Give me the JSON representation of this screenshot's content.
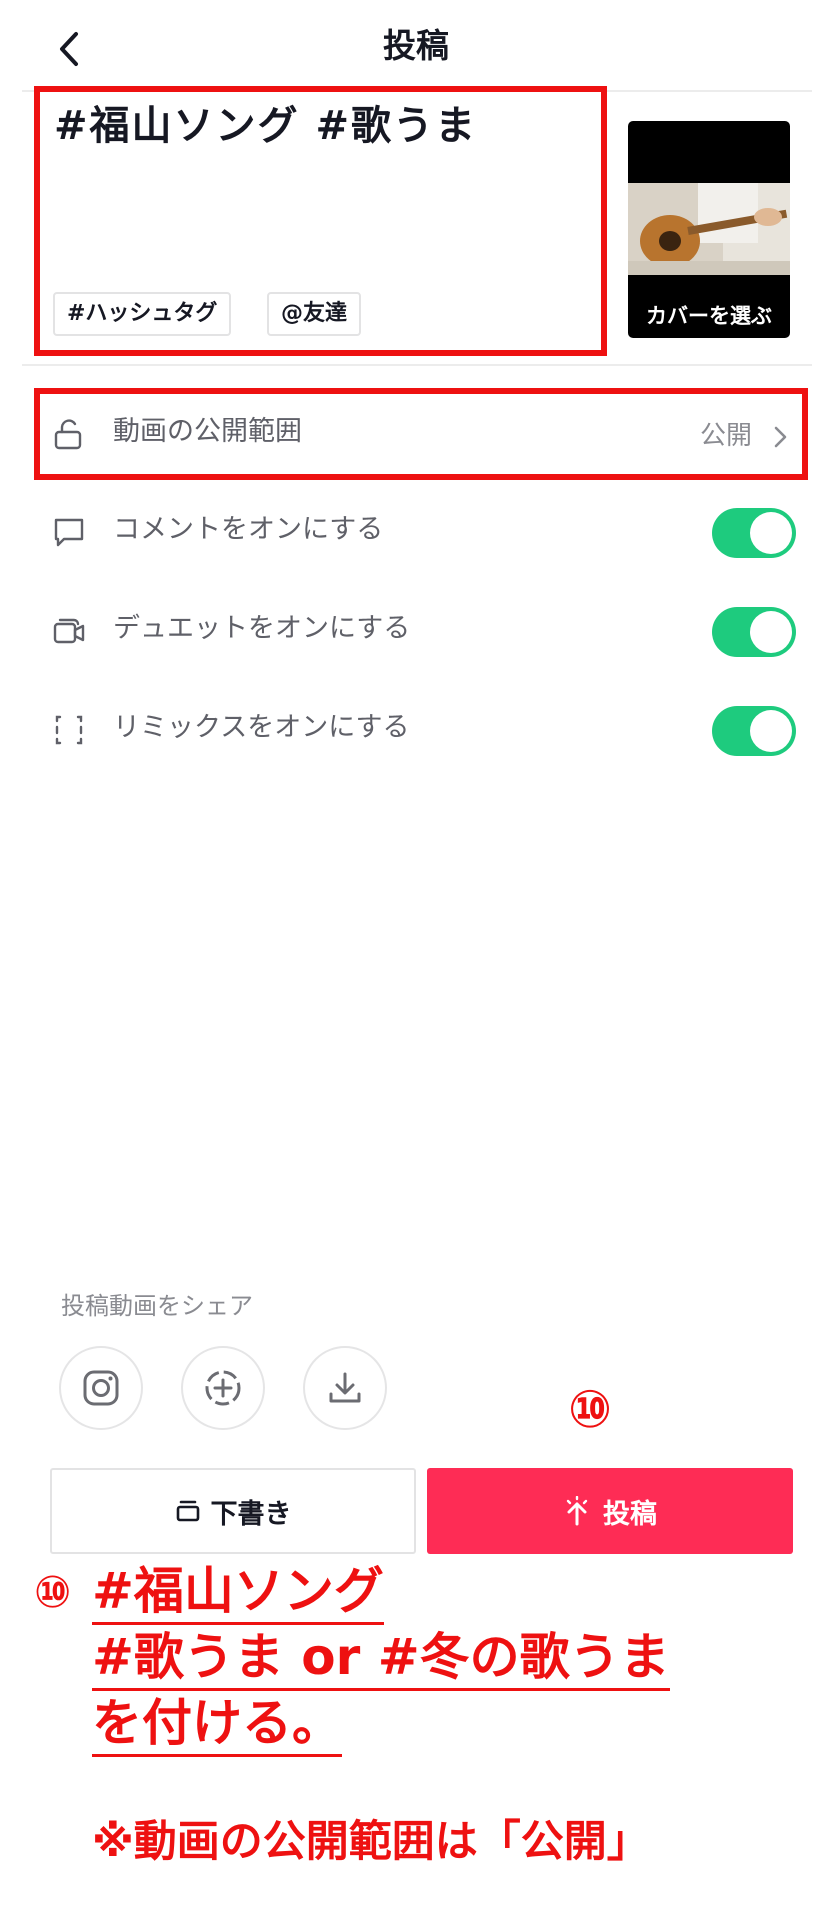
{
  "header": {
    "title": "投稿"
  },
  "caption": {
    "text": "#福山ソング #歌うま",
    "chips": [
      "#ハッシュタグ",
      "@友達"
    ]
  },
  "cover": {
    "label": "カバーを選ぶ"
  },
  "settings": {
    "privacy": {
      "label": "動画の公開範囲",
      "value": "公開"
    },
    "toggles": [
      {
        "label": "コメントをオンにする",
        "on": true
      },
      {
        "label": "デュエットをオンにする",
        "on": true
      },
      {
        "label": "リミックスをオンにする",
        "on": true
      }
    ]
  },
  "share": {
    "label": "投稿動画をシェア",
    "icons": [
      "instagram-icon",
      "add-circle-icon",
      "download-icon"
    ]
  },
  "actions": {
    "draft_label": "下書き",
    "post_label": "投稿"
  },
  "annotation": {
    "badge": "⑩",
    "line1": "#福山ソング",
    "line2": "#歌うま or #冬の歌うま",
    "line3": "を付ける。",
    "note": "※動画の公開範囲は「公開」"
  },
  "colors": {
    "accent": "#fe2c55",
    "toggle_on": "#1ecb7e",
    "annotation": "#ee1111"
  }
}
